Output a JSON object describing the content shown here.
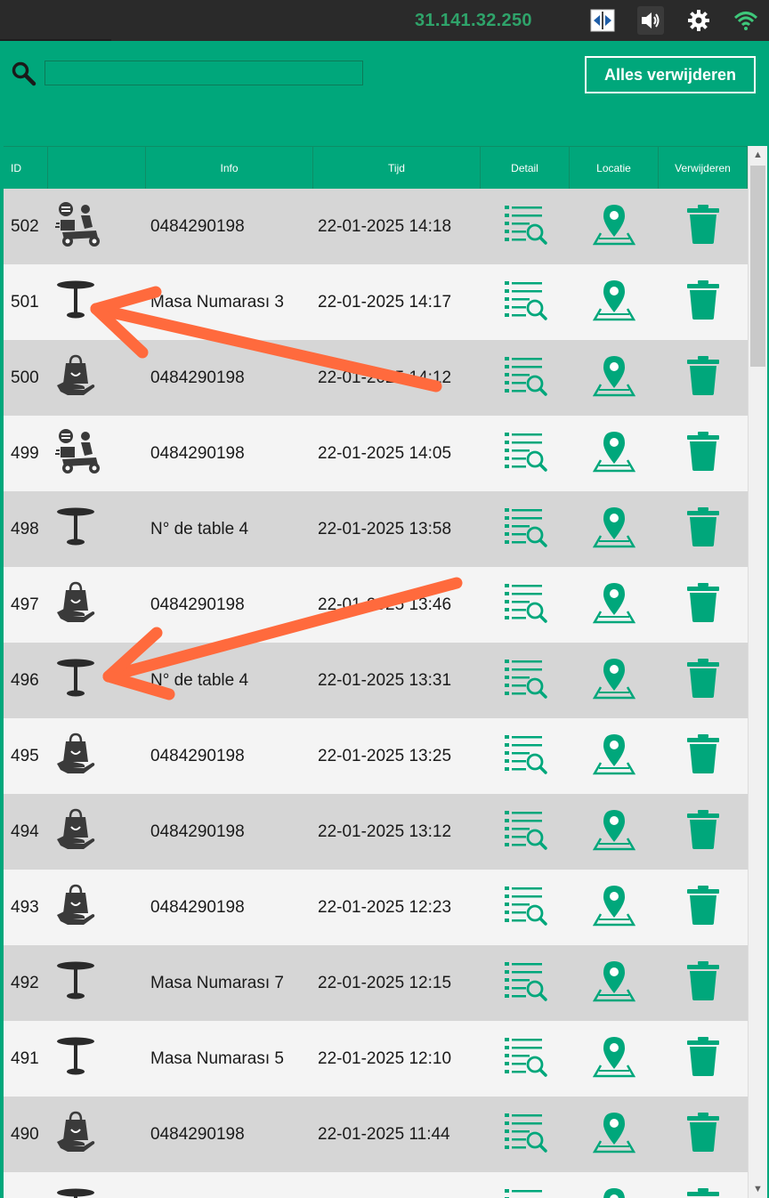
{
  "statusbar": {
    "ip": "31.141.32.250"
  },
  "header": {
    "search_value": "",
    "clear_all_label": "Alles verwijderen"
  },
  "table": {
    "columns": {
      "id": "ID",
      "icon": "",
      "info": "Info",
      "time": "Tijd",
      "detail": "Detail",
      "location": "Locatie",
      "delete": "Verwijderen"
    },
    "rows": [
      {
        "id": "502",
        "type": "delivery-scooter-icon",
        "info": "0484290198",
        "time": "22-01-2025 14:18"
      },
      {
        "id": "501",
        "type": "table-icon",
        "info": "Masa Numarası 3",
        "time": "22-01-2025 14:17"
      },
      {
        "id": "500",
        "type": "takeaway-bag-icon",
        "info": "0484290198",
        "time": "22-01-2025 14:12"
      },
      {
        "id": "499",
        "type": "delivery-scooter-icon",
        "info": "0484290198",
        "time": "22-01-2025 14:05"
      },
      {
        "id": "498",
        "type": "table-icon",
        "info": "N° de table 4",
        "time": "22-01-2025 13:58"
      },
      {
        "id": "497",
        "type": "takeaway-bag-icon",
        "info": "0484290198",
        "time": "22-01-2025 13:46"
      },
      {
        "id": "496",
        "type": "table-icon",
        "info": "N° de table 4",
        "time": "22-01-2025 13:31"
      },
      {
        "id": "495",
        "type": "takeaway-bag-icon",
        "info": "0484290198",
        "time": "22-01-2025 13:25"
      },
      {
        "id": "494",
        "type": "takeaway-bag-icon",
        "info": "0484290198",
        "time": "22-01-2025 13:12"
      },
      {
        "id": "493",
        "type": "takeaway-bag-icon",
        "info": "0484290198",
        "time": "22-01-2025 12:23"
      },
      {
        "id": "492",
        "type": "table-icon",
        "info": "Masa Numarası 7",
        "time": "22-01-2025 12:15"
      },
      {
        "id": "491",
        "type": "table-icon",
        "info": "Masa Numarası 5",
        "time": "22-01-2025 12:10"
      },
      {
        "id": "490",
        "type": "takeaway-bag-icon",
        "info": "0484290198",
        "time": "22-01-2025 11:44"
      },
      {
        "id": "",
        "type": "table-icon",
        "info": "",
        "time": ""
      }
    ]
  },
  "colors": {
    "accent": "#00a77b",
    "arrow": "#ff6a3d",
    "row_dark": "#d6d6d6",
    "row_light": "#f4f4f4",
    "icon_dark": "#3a3a3a"
  }
}
